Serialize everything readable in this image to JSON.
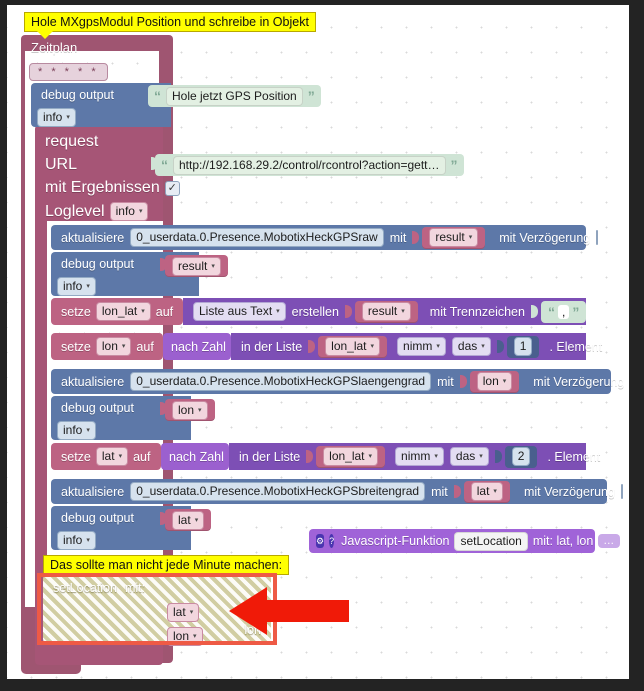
{
  "app": {
    "name": "blockly-script-editor",
    "canvas_bg": "#ffffff",
    "frame_color": "#232323"
  },
  "comments": [
    {
      "id": "top-comment",
      "text": "Hole MXgpsModul Position und schreibe in Objekt"
    },
    {
      "id": "bottom-comment",
      "text": "Das sollte man nicht jede Minute machen:"
    }
  ],
  "schedule": {
    "label": "Zeitplan",
    "cron": "* * * * *"
  },
  "debug_top": {
    "label": "debug output",
    "level": "info",
    "text": "Hole jetzt GPS Position",
    "quote_open": "“",
    "quote_close": "”"
  },
  "request": {
    "label": "request",
    "url_label": "URL",
    "url_value": "http://192.168.29.2/control/rcontrol?action=gett…",
    "with_results_label": "mit Ergebnissen",
    "with_results_checked": "✓",
    "loglevel_label": "Loglevel",
    "loglevel_value": "info"
  },
  "statements": [
    {
      "type": "update",
      "label": "aktualisiere",
      "object": "0_userdata.0.Presence.MobotixHeckGPSraw",
      "mit": "mit",
      "value": "result",
      "delay_label": "mit Verzögerung",
      "delay_checked": ""
    },
    {
      "type": "debug",
      "label": "debug output",
      "value": "result",
      "level": "info"
    },
    {
      "type": "set_list",
      "label": "setze",
      "variable": "lon_lat",
      "auf": "auf",
      "list_from": "Liste aus Text",
      "erstellen": "erstellen",
      "source": "result",
      "sep_label": "mit Trennzeichen",
      "separator": ","
    },
    {
      "type": "set_index",
      "label": "setze",
      "variable": "lon",
      "auf": "auf",
      "to_number": "nach Zahl",
      "in_list": "in der Liste",
      "list": "lon_lat",
      "nimm": "nimm",
      "das": "das",
      "index": "1",
      "element": ". Element"
    },
    {
      "type": "update",
      "label": "aktualisiere",
      "object": "0_userdata.0.Presence.MobotixHeckGPSlaengengrad",
      "mit": "mit",
      "value": "lon",
      "delay_label": "mit Verzögerung",
      "delay_checked": ""
    },
    {
      "type": "debug",
      "label": "debug output",
      "value": "lon",
      "level": "info"
    },
    {
      "type": "set_index",
      "label": "setze",
      "variable": "lat",
      "auf": "auf",
      "to_number": "nach Zahl",
      "in_list": "in der Liste",
      "list": "lon_lat",
      "nimm": "nimm",
      "das": "das",
      "index": "2",
      "element": ". Element"
    },
    {
      "type": "update",
      "label": "aktualisiere",
      "object": "0_userdata.0.Presence.MobotixHeckGPSbreitengrad",
      "mit": "mit",
      "value": "lat",
      "delay_label": "mit Verzögerung",
      "delay_checked": ""
    },
    {
      "type": "debug",
      "label": "debug output",
      "value": "lat",
      "level": "info"
    }
  ],
  "js_function": {
    "gear_icon": "⚙",
    "help_icon": "?",
    "label": "Javascript-Funktion",
    "name": "setLocation",
    "params_label": "mit: lat, lon",
    "more": "…"
  },
  "set_location_call": {
    "name": "setLocation",
    "mit": "mit:",
    "args": [
      {
        "label": "lat",
        "value": "lat"
      },
      {
        "label": "lon",
        "value": "lon"
      }
    ],
    "disabled": true
  },
  "annotation": {
    "highlight_color": "#ee5a45",
    "arrow_color": "#f01a08",
    "arrow_direction": "left"
  }
}
